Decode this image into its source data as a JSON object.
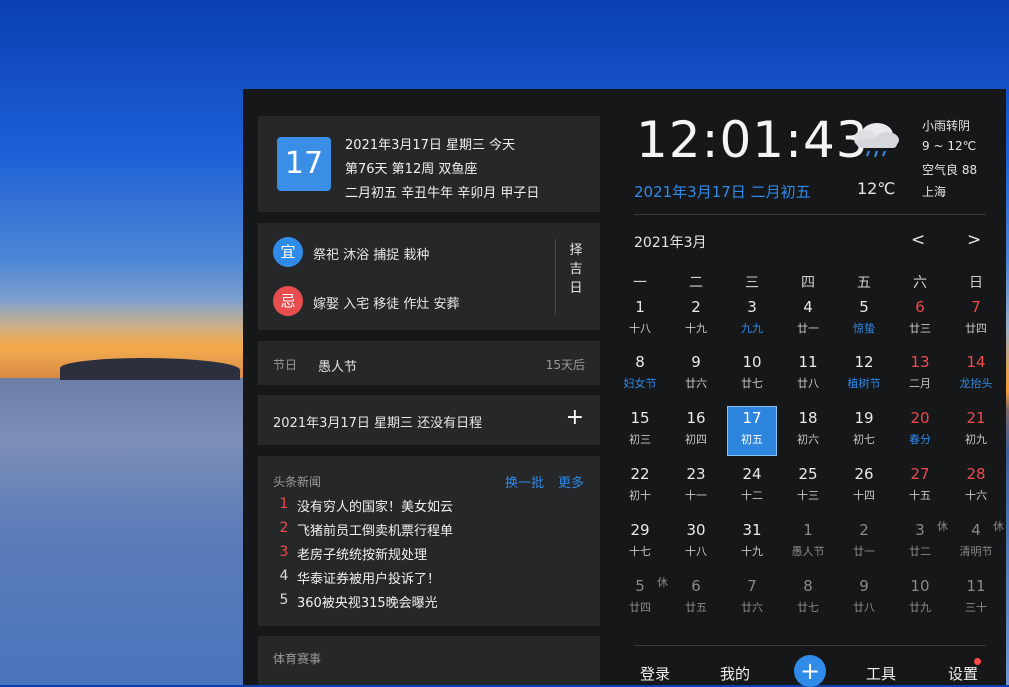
{
  "date_card": {
    "day": "17",
    "line1": "2021年3月17日 星期三 今天",
    "line2": "第76天 第12周 双鱼座",
    "line3": "二月初五 辛丑牛年 辛卯月 甲子日"
  },
  "yiji": {
    "yi_label": "宜",
    "yi_text": "祭祀 沐浴 捕捉 栽种",
    "ji_label": "忌",
    "ji_text": "嫁娶 入宅 移徒 作灶 安葬",
    "zeji": [
      "择",
      "吉",
      "日"
    ],
    "colors": {
      "yi": "#2f8ae8",
      "ji": "#e84e4e"
    }
  },
  "festival": {
    "label": "节日",
    "name": "愚人节",
    "countdown": "15天后"
  },
  "schedule": {
    "text": "2021年3月17日 星期三 还没有日程",
    "add": "+"
  },
  "news": {
    "title": "头条新闻",
    "refresh": "换一批",
    "more": "更多",
    "items": [
      {
        "num": "1",
        "text": "没有穷人的国家！美女如云"
      },
      {
        "num": "2",
        "text": "飞猪前员工倒卖机票行程单"
      },
      {
        "num": "3",
        "text": "老房子统统按新规处理"
      },
      {
        "num": "4",
        "text": "华泰证券被用户投诉了！"
      },
      {
        "num": "5",
        "text": "360被央视315晚会曝光"
      }
    ]
  },
  "sports": {
    "title": "体育赛事"
  },
  "clock": {
    "time": "12:01:43",
    "date": "2021年3月17日 二月初五"
  },
  "weather": {
    "icon": "rain-cloud-icon",
    "temp": "12℃",
    "desc": "小雨转阴",
    "range": "9 ~ 12℃",
    "aqi": "空气良 88",
    "city": "上海"
  },
  "calendar": {
    "month": "2021年3月",
    "prev": "<",
    "next": ">",
    "weekdays": [
      "一",
      "二",
      "三",
      "四",
      "五",
      "六",
      "日"
    ],
    "rows": [
      [
        {
          "d": "1",
          "l": "十八"
        },
        {
          "d": "2",
          "l": "十九"
        },
        {
          "d": "3",
          "l": "九九",
          "hl": true
        },
        {
          "d": "4",
          "l": "廿一"
        },
        {
          "d": "5",
          "l": "惊蛰",
          "hl": true
        },
        {
          "d": "6",
          "l": "廿三",
          "wk": true
        },
        {
          "d": "7",
          "l": "廿四",
          "wk": true
        }
      ],
      [
        {
          "d": "8",
          "l": "妇女节",
          "hl": true
        },
        {
          "d": "9",
          "l": "廿六"
        },
        {
          "d": "10",
          "l": "廿七"
        },
        {
          "d": "11",
          "l": "廿八"
        },
        {
          "d": "12",
          "l": "植树节",
          "hl": true
        },
        {
          "d": "13",
          "l": "二月",
          "wk": true
        },
        {
          "d": "14",
          "l": "龙抬头",
          "wk": true,
          "hl": true
        }
      ],
      [
        {
          "d": "15",
          "l": "初三"
        },
        {
          "d": "16",
          "l": "初四"
        },
        {
          "d": "17",
          "l": "初五",
          "today": true
        },
        {
          "d": "18",
          "l": "初六"
        },
        {
          "d": "19",
          "l": "初七"
        },
        {
          "d": "20",
          "l": "春分",
          "wk": true,
          "hl": true
        },
        {
          "d": "21",
          "l": "初九",
          "wk": true
        }
      ],
      [
        {
          "d": "22",
          "l": "初十"
        },
        {
          "d": "23",
          "l": "十一"
        },
        {
          "d": "24",
          "l": "十二"
        },
        {
          "d": "25",
          "l": "十三"
        },
        {
          "d": "26",
          "l": "十四"
        },
        {
          "d": "27",
          "l": "十五",
          "wk": true
        },
        {
          "d": "28",
          "l": "十六",
          "wk": true
        }
      ],
      [
        {
          "d": "29",
          "l": "十七"
        },
        {
          "d": "30",
          "l": "十八"
        },
        {
          "d": "31",
          "l": "十九"
        },
        {
          "d": "1",
          "l": "愚人节",
          "dim": true
        },
        {
          "d": "2",
          "l": "廿一",
          "dim": true
        },
        {
          "d": "3",
          "l": "廿二",
          "dim": true,
          "tag": "休"
        },
        {
          "d": "4",
          "l": "清明节",
          "dim": true,
          "tag": "休"
        }
      ],
      [
        {
          "d": "5",
          "l": "廿四",
          "dim": true,
          "tag": "休"
        },
        {
          "d": "6",
          "l": "廿五",
          "dim": true
        },
        {
          "d": "7",
          "l": "廿六",
          "dim": true
        },
        {
          "d": "8",
          "l": "廿七",
          "dim": true
        },
        {
          "d": "9",
          "l": "廿八",
          "dim": true
        },
        {
          "d": "10",
          "l": "廿九",
          "dim": true
        },
        {
          "d": "11",
          "l": "三十",
          "dim": true
        }
      ]
    ]
  },
  "bottom_bar": {
    "login": "登录",
    "mine": "我的",
    "add": "+",
    "tools": "工具",
    "settings": "设置"
  }
}
